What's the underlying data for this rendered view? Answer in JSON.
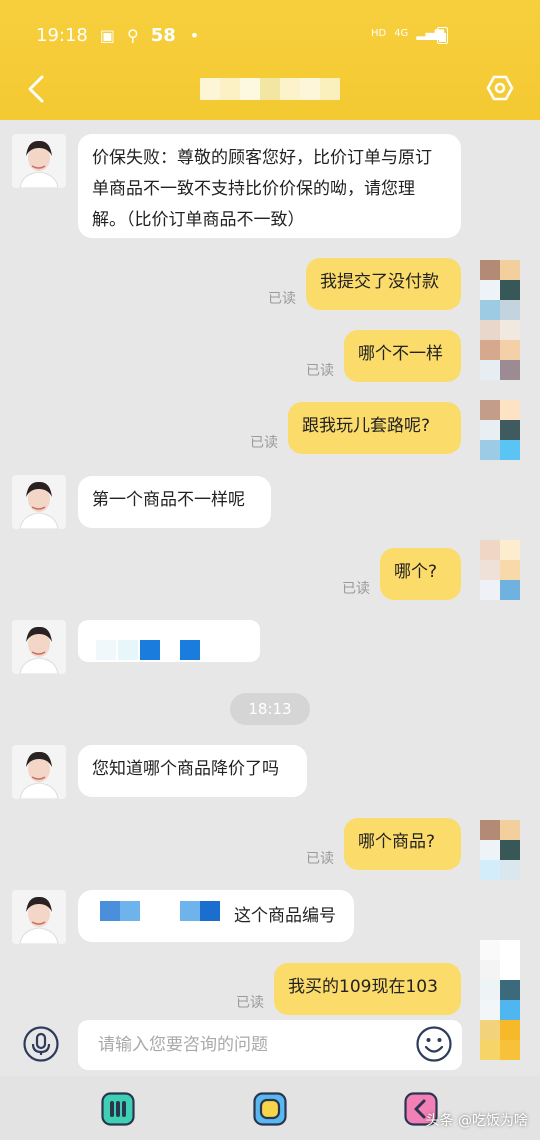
{
  "status_bar": {
    "time": "19:18",
    "badge": "58",
    "dot": "•",
    "hd": "HD",
    "net": "4G"
  },
  "header": {
    "title": ""
  },
  "messages": {
    "m1": "价保失败：尊敬的顾客您好，比价订单与原订单商品不一致不支持比价价保的呦，请您理解。（比价订单商品不一致）",
    "m2": "我提交了没付款",
    "m3": "哪个不一样",
    "m4": "跟我玩儿套路呢?",
    "m5": "第一个商品不一样呢",
    "m6": "哪个?",
    "m7": "您知道哪个商品降价了吗",
    "m8": "哪个商品?",
    "m9": "这个商品编号",
    "m10": "我买的109现在103"
  },
  "read_label": "已读",
  "timestamp": "18:13",
  "input": {
    "placeholder": "请输入您要咨询的问题"
  },
  "watermark": "头条 @吃饭为啥"
}
